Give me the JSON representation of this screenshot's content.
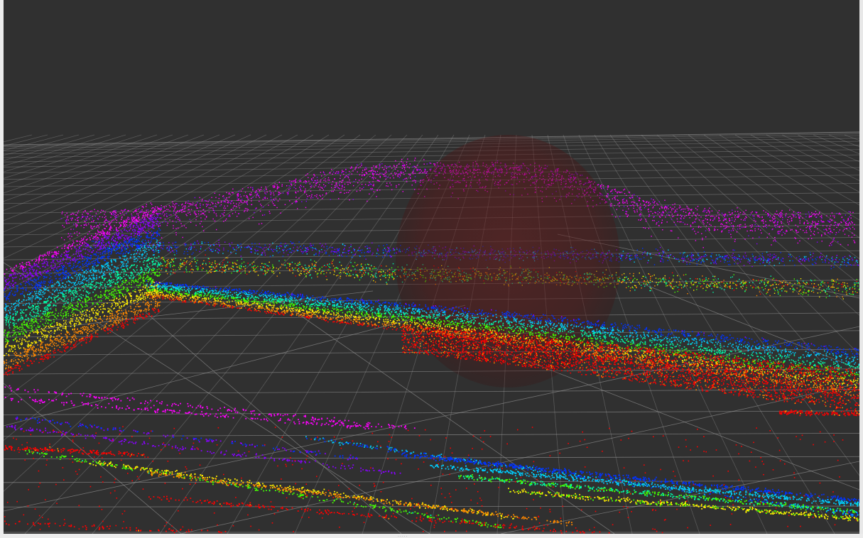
{
  "viewport": {
    "background_color": "#303030",
    "grid_color": "#a6a6a6",
    "sphere_color": "#5a1616",
    "color_ramp": [
      "#ff0000",
      "#ff8800",
      "#ffee00",
      "#44ff00",
      "#00ffaa",
      "#00ccff",
      "#0033ff",
      "#8800ff",
      "#ff00ff"
    ]
  },
  "resize_handle": {
    "glyph": "....."
  }
}
